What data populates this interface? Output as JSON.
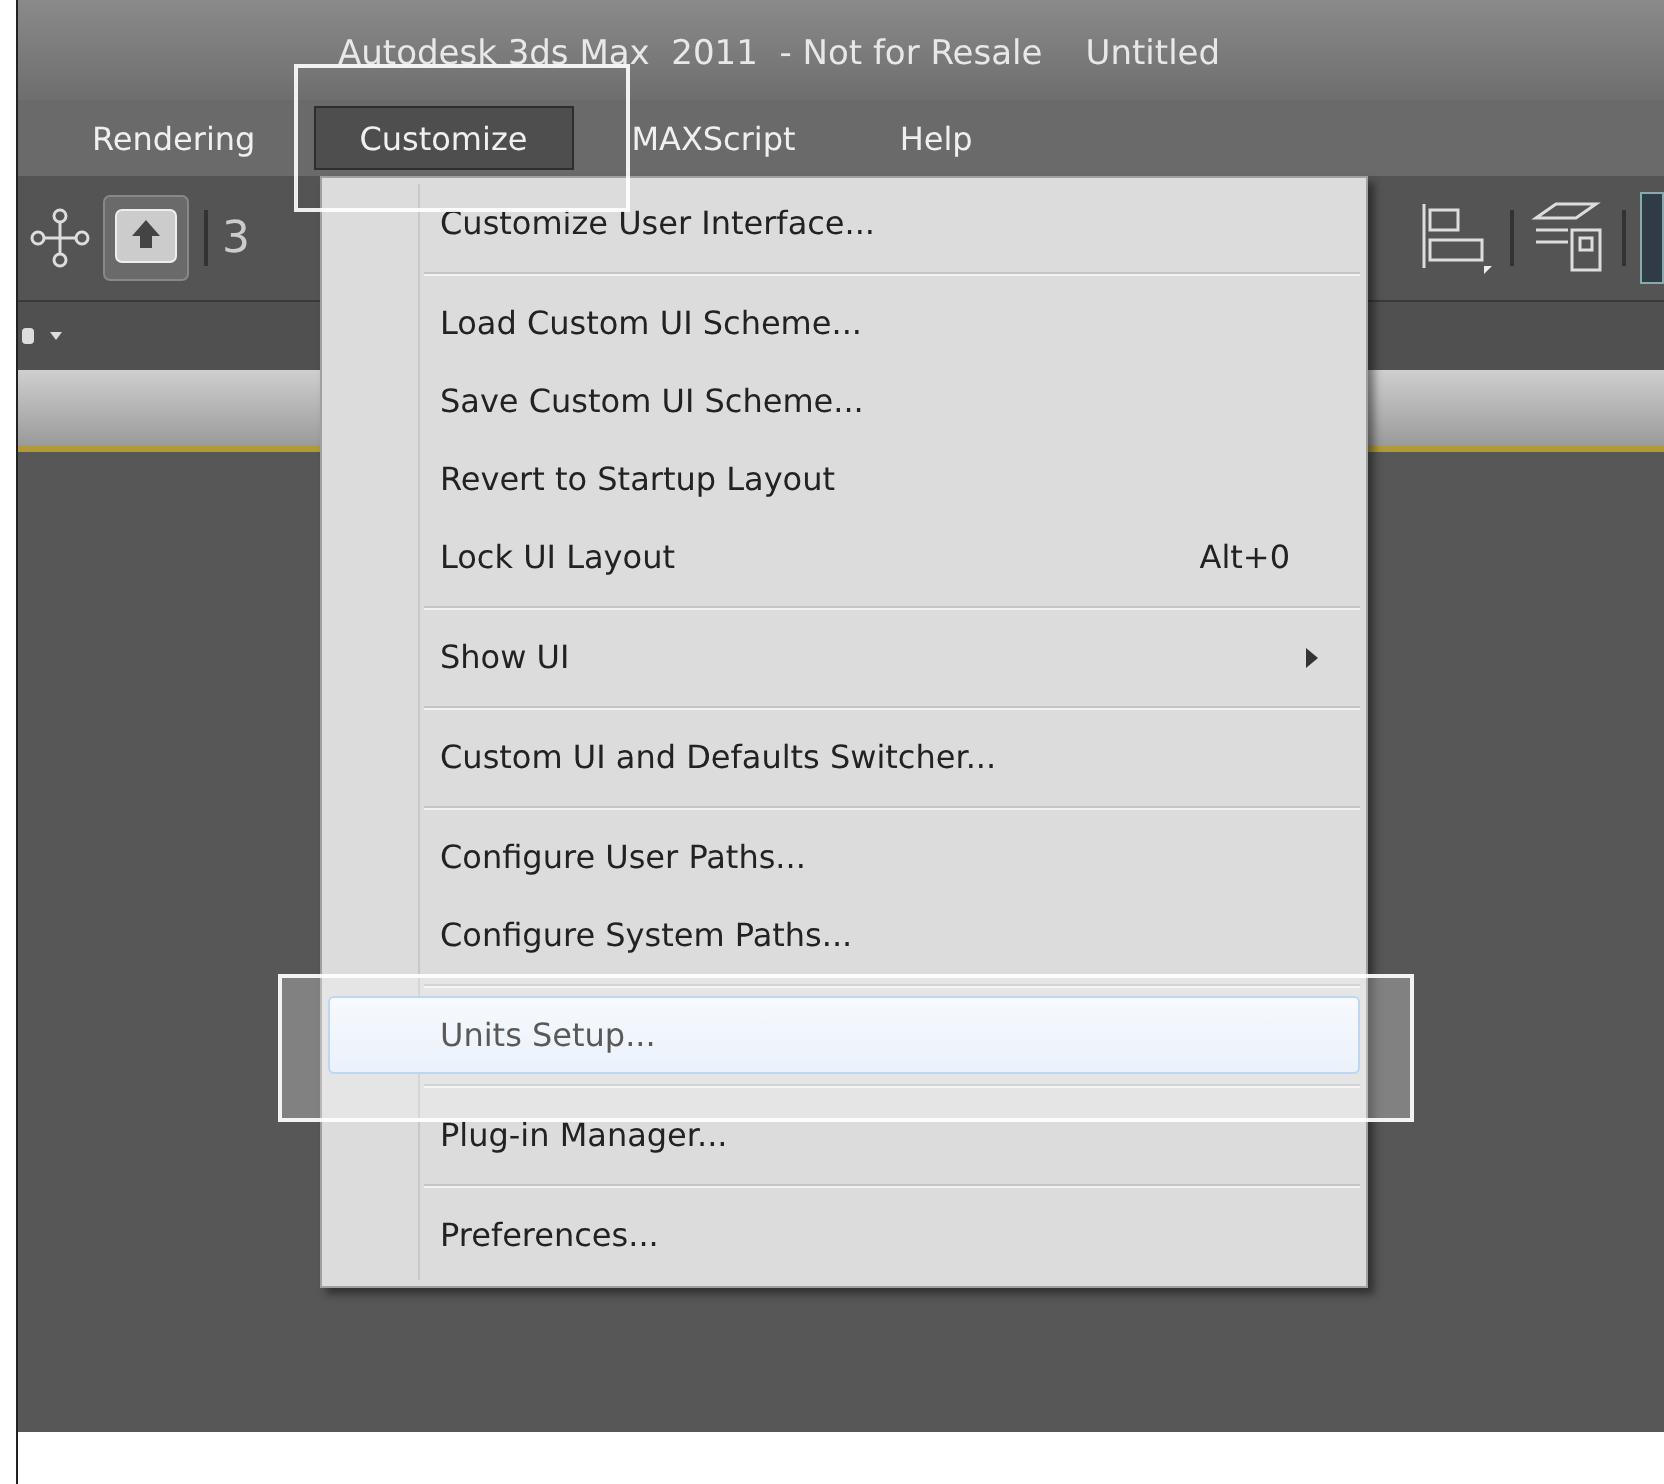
{
  "window": {
    "title": "Autodesk 3ds Max  2011  - Not for Resale    Untitled"
  },
  "menu_bar": [
    {
      "label": "Rendering",
      "selected": false
    },
    {
      "label": "Customize",
      "selected": true
    },
    {
      "label": "MAXScript",
      "selected": false
    },
    {
      "label": "Help",
      "selected": false
    }
  ],
  "toolbar": {
    "partial_text": "3"
  },
  "dropdown": [
    {
      "kind": "item",
      "label": "Customize User Interface...",
      "selected": false
    },
    {
      "kind": "separator"
    },
    {
      "kind": "item",
      "label": "Load Custom UI Scheme...",
      "selected": false
    },
    {
      "kind": "item",
      "label": "Save Custom UI Scheme...",
      "selected": false
    },
    {
      "kind": "item",
      "label": "Revert to Startup Layout",
      "selected": false
    },
    {
      "kind": "item",
      "label": "Lock UI Layout",
      "shortcut": "Alt+0",
      "selected": false
    },
    {
      "kind": "separator"
    },
    {
      "kind": "submenu",
      "label": "Show UI",
      "selected": false
    },
    {
      "kind": "separator"
    },
    {
      "kind": "item",
      "label": "Custom UI and Defaults Switcher...",
      "selected": false
    },
    {
      "kind": "separator"
    },
    {
      "kind": "item",
      "label": "Configure User Paths...",
      "selected": false
    },
    {
      "kind": "item",
      "label": "Configure System Paths...",
      "selected": false
    },
    {
      "kind": "separator"
    },
    {
      "kind": "item",
      "label": "Units Setup...",
      "selected": true
    },
    {
      "kind": "separator"
    },
    {
      "kind": "item",
      "label": "Plug-in Manager...",
      "selected": false
    },
    {
      "kind": "separator"
    },
    {
      "kind": "item",
      "label": "Preferences...",
      "selected": false
    }
  ]
}
